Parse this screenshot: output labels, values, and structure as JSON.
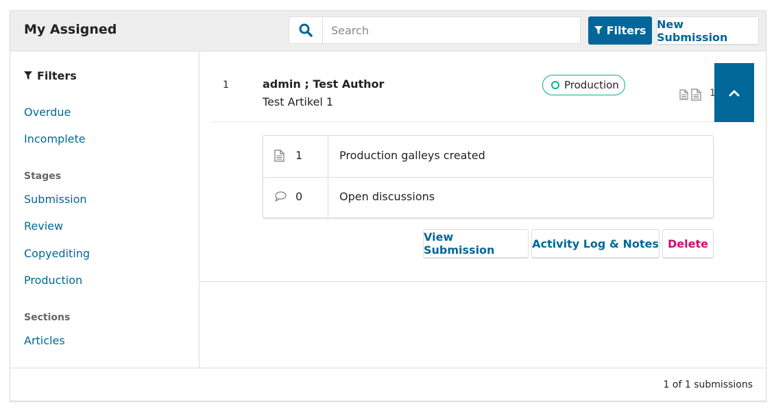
{
  "header": {
    "title": "My Assigned",
    "search_placeholder": "Search",
    "search_value": "",
    "filters_label": "Filters",
    "new_submission_label": "New Submission"
  },
  "sidebar": {
    "heading": "Filters",
    "quick_filters": [
      "Overdue",
      "Incomplete"
    ],
    "stages_label": "Stages",
    "stages": [
      "Submission",
      "Review",
      "Copyediting",
      "Production"
    ],
    "sections_label": "Sections",
    "sections": [
      "Articles"
    ]
  },
  "submission": {
    "id": "1",
    "authors": "admin ; Test Author",
    "title": "Test Artikel 1",
    "stage": "Production",
    "file_count": "1",
    "details": [
      {
        "icon": "document-icon",
        "count": "1",
        "label": "Production galleys created"
      },
      {
        "icon": "speech-bubble-icon",
        "count": "0",
        "label": "Open discussions"
      }
    ],
    "actions": {
      "view": "View Submission",
      "log": "Activity Log & Notes",
      "delete": "Delete"
    }
  },
  "footer": {
    "pagination": "1 of 1 submissions"
  },
  "colors": {
    "primary": "#006798",
    "stage_production": "#00b28d",
    "delete": "#d00a6c",
    "header_bg": "#eeeeee"
  }
}
